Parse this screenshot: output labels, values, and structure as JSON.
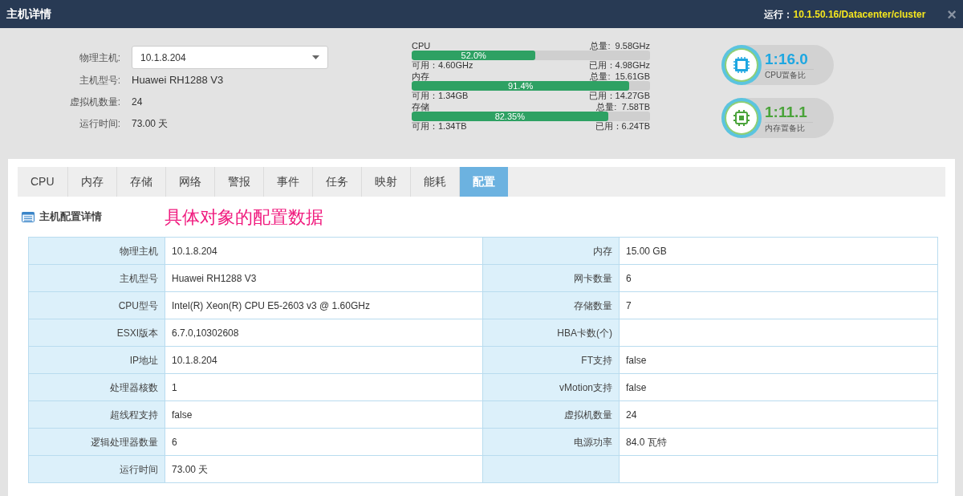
{
  "window": {
    "title": "主机详情",
    "location_label": "运行：",
    "location": "10.1.50.16/Datacenter/cluster",
    "close": "×"
  },
  "host_info": {
    "host_label": "物理主机:",
    "host_value": "10.1.8.204",
    "fields": [
      {
        "label": "主机型号:",
        "value": "Huawei RH1288 V3"
      },
      {
        "label": "虚拟机数量:",
        "value": "24"
      },
      {
        "label": "运行时间:",
        "value": "73.00 天"
      }
    ]
  },
  "usage": [
    {
      "name": "CPU",
      "total": "总量:  9.58GHz",
      "percent": "52.0%",
      "level": 0.52,
      "available": "可用：4.60GHz",
      "used": "已用：4.98GHz"
    },
    {
      "name": "内存",
      "total": "总量:  15.61GB",
      "percent": "91.4%",
      "level": 0.914,
      "available": "可用：1.34GB",
      "used": "已用：14.27GB"
    },
    {
      "name": "存储",
      "total": "总量:  7.58TB",
      "percent": "82.35%",
      "level": 0.8235,
      "available": "可用：1.34TB",
      "used": "已用：6.24TB"
    }
  ],
  "ratios": [
    {
      "kind": "cpu",
      "value": "1:16.0",
      "label": "CPU置备比",
      "color": "#1ea7e1"
    },
    {
      "kind": "memory",
      "value": "1:11.1",
      "label": "内存置备比",
      "color": "#4aa33a"
    }
  ],
  "tabs": [
    {
      "label": "CPU",
      "selected": false
    },
    {
      "label": "内存",
      "selected": false
    },
    {
      "label": "存储",
      "selected": false
    },
    {
      "label": "网络",
      "selected": false
    },
    {
      "label": "警报",
      "selected": false
    },
    {
      "label": "事件",
      "selected": false
    },
    {
      "label": "任务",
      "selected": false
    },
    {
      "label": "映射",
      "selected": false
    },
    {
      "label": "能耗",
      "selected": false
    },
    {
      "label": "配置",
      "selected": true
    }
  ],
  "section_title": "主机配置详情",
  "annotation": "具体对象的配置数据",
  "table": {
    "rows": [
      [
        "物理主机",
        "10.1.8.204",
        "内存",
        "15.00 GB"
      ],
      [
        "主机型号",
        "Huawei RH1288 V3",
        "网卡数量",
        "6"
      ],
      [
        "CPU型号",
        "Intel(R) Xeon(R) CPU E5-2603 v3 @ 1.60GHz",
        "存储数量",
        "7"
      ],
      [
        "ESXI版本",
        "6.7.0,10302608",
        "HBA卡数(个)",
        ""
      ],
      [
        "IP地址",
        "10.1.8.204",
        "FT支持",
        "false"
      ],
      [
        "处理器核数",
        "1",
        "vMotion支持",
        "false"
      ],
      [
        "超线程支持",
        "false",
        "虚拟机数量",
        "24"
      ],
      [
        "逻辑处理器数量",
        "6",
        "电源功率",
        "84.0 瓦特"
      ],
      [
        "运行时间",
        "73.00 天",
        "",
        ""
      ]
    ]
  }
}
